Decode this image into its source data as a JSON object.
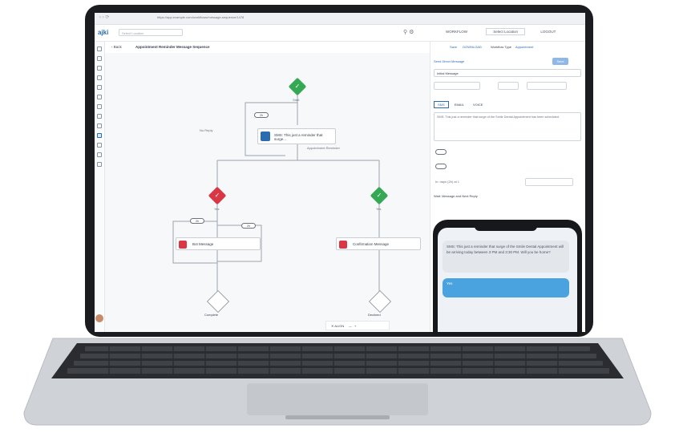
{
  "browser": {
    "url": "https://app.example.com/workflows/message-sequence/1478"
  },
  "app": {
    "logo": "ajki",
    "search_placeholder": "Select Location",
    "right_tabs": [
      "WORKFLOW",
      "Select Location",
      "LOGOUT"
    ],
    "page_title": "Appointment Reminder Message Sequence",
    "back_label": "Back",
    "toolbar_right": [
      "Save",
      "DOWNLOAD",
      "Workflow Type",
      "Appointment"
    ],
    "zoom_label": "ALIGN"
  },
  "canvas": {
    "start_label": "Start",
    "ok_label": "Yes",
    "action_card": "SMS: This just a reminder that surge...",
    "action_sublabel": "Appointment Reminder",
    "no_label": "No Reply",
    "left_node_label": "Yes",
    "right_node_label": "Yes",
    "left_card": "Bot Message",
    "right_card": "Confirmation Message",
    "left_end": "Complete",
    "right_end": "Declined",
    "pill1": "2h",
    "pill2": "2h",
    "pill3": "2h"
  },
  "right_panel": {
    "section_title": "Send Direct Message",
    "name_value": "Initial Message",
    "action_button": "Save",
    "tabs": [
      "SMS",
      "EMAIL",
      "VOICE"
    ],
    "message_text": "SMS: This just a reminder that surge of the Smile Dental Appointment has been scheduled.",
    "wait_label": "Wait: Message and Next Reply",
    "delay_label": "In: days (2h) at 1"
  },
  "phone": {
    "incoming": "SMS: This just a reminder that surge of the Smile Dental Appointment will be arriving today between 3 PM and 3:30 PM. Will you be home?",
    "outgoing": "Yes"
  },
  "colors": {
    "accent_blue": "#2b6cb0",
    "success_green": "#34a853",
    "danger_red": "#d93744",
    "phone_bubble": "#4aa3df"
  }
}
